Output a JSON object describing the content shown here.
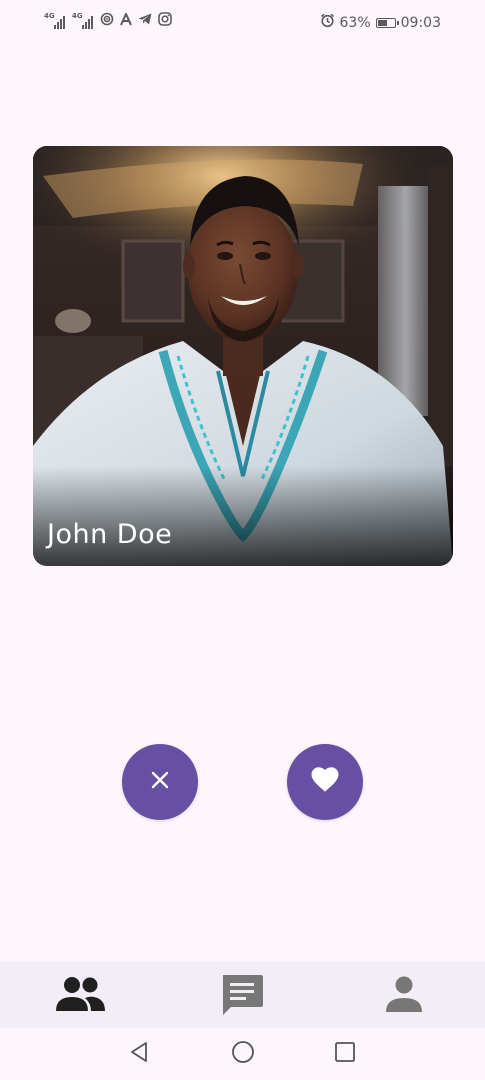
{
  "status_bar": {
    "network_1": "4G",
    "network_2": "4G",
    "battery_percent": "63%",
    "battery_level": 0.63,
    "time": "09:03",
    "icons": [
      "signal-icon",
      "signal-icon",
      "hotspot-icon",
      "a-icon",
      "telegram-icon",
      "instagram-icon",
      "alarm-icon",
      "battery-icon"
    ]
  },
  "profile": {
    "name": "John Doe"
  },
  "actions": {
    "dislike_icon": "close-icon",
    "like_icon": "heart-icon"
  },
  "bottom_nav": {
    "items": [
      {
        "icon": "people-icon"
      },
      {
        "icon": "chat-icon"
      },
      {
        "icon": "person-icon"
      }
    ]
  },
  "system_nav": {
    "items": [
      {
        "icon": "back-icon"
      },
      {
        "icon": "home-icon"
      },
      {
        "icon": "recents-icon"
      }
    ]
  },
  "colors": {
    "background": "#fdf6fc",
    "accent": "#6750a4",
    "nav_background": "#f3edf7",
    "nav_icon": "#202020",
    "nav_icon_inactive": "#777777"
  }
}
